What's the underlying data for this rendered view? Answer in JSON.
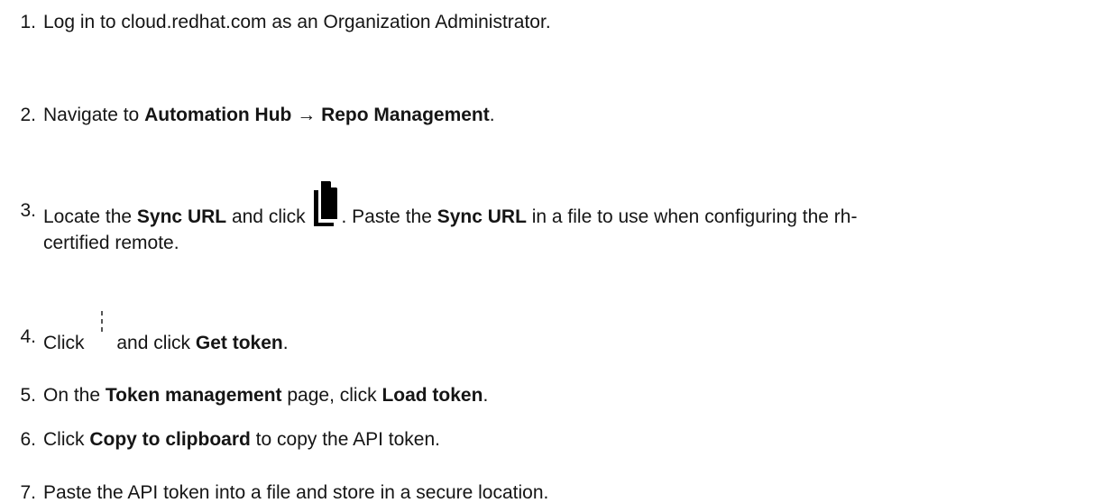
{
  "steps": [
    {
      "num": "1.",
      "text": "Log in to cloud.redhat.com as an Organization Administrator."
    },
    {
      "num": "2.",
      "pre": "Navigate to ",
      "bold1": "Automation Hub",
      "arrow": " → ",
      "bold2": "Repo Management",
      "post": "."
    },
    {
      "num": "3.",
      "pre": "Locate the ",
      "bold1": "Sync URL",
      "mid1": " and click ",
      "icon": "copy-icon",
      "mid2": ". Paste the ",
      "bold2": "Sync URL",
      "line1_end": " in a file to use when configuring the rh-",
      "line2": "certified remote."
    },
    {
      "num": "4.",
      "pre": "Click ",
      "icon": "kebab-icon",
      "mid": "and click ",
      "bold": "Get token",
      "post": "."
    },
    {
      "num": "5.",
      "pre": "On the ",
      "bold1": "Token management",
      "mid": " page, click ",
      "bold2": "Load token",
      "post": "."
    },
    {
      "num": "6.",
      "pre": "Click ",
      "bold": "Copy to clipboard",
      "post": " to copy the API token."
    },
    {
      "num": "7.",
      "text": "Paste the API token into a file and store in a secure location."
    }
  ],
  "colors": {
    "text": "#151515",
    "background": "#ffffff",
    "icon": "#000000"
  }
}
